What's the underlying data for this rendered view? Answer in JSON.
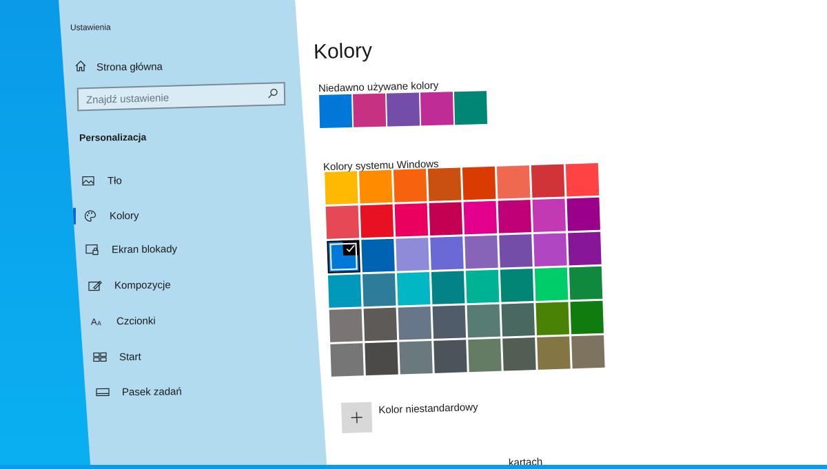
{
  "window": {
    "title": "Ustawienia"
  },
  "sidebar": {
    "home_label": "Strona główna",
    "search_placeholder": "Znajdź ustawienie",
    "section_title": "Personalizacja",
    "items": [
      {
        "label": "Tło",
        "icon": "picture-icon"
      },
      {
        "label": "Kolory",
        "icon": "palette-icon",
        "active": true
      },
      {
        "label": "Ekran blokady",
        "icon": "lock-screen-icon"
      },
      {
        "label": "Kompozycje",
        "icon": "themes-icon"
      },
      {
        "label": "Czcionki",
        "icon": "fonts-icon"
      },
      {
        "label": "Start",
        "icon": "start-icon"
      },
      {
        "label": "Pasek zadań",
        "icon": "taskbar-icon"
      }
    ]
  },
  "main": {
    "title": "Kolory",
    "recent_label": "Niedawno używane kolory",
    "recent_colors": [
      "#0078d7",
      "#c73181",
      "#744da9",
      "#c02c96",
      "#018574"
    ],
    "windows_label": "Kolory systemu Windows",
    "windows_colors": [
      [
        "#ffb900",
        "#ff8c00",
        "#f7630c",
        "#ca5010",
        "#da3b01",
        "#ef6950",
        "#d13438",
        "#ff4343"
      ],
      [
        "#e74856",
        "#e81123",
        "#ea005e",
        "#c30052",
        "#e3008c",
        "#bf0077",
        "#c239b3",
        "#9a0089"
      ],
      [
        "#0078d7",
        "#0063b1",
        "#8e8cd8",
        "#6b69d6",
        "#8764b8",
        "#744da9",
        "#b146c2",
        "#881798"
      ],
      [
        "#0099bc",
        "#2d7d9a",
        "#00b7c3",
        "#038387",
        "#00b294",
        "#018574",
        "#00cc6a",
        "#10893e"
      ],
      [
        "#7a7574",
        "#5d5a58",
        "#68768a",
        "#515c6b",
        "#567c73",
        "#486860",
        "#498205",
        "#107c10"
      ],
      [
        "#767676",
        "#4c4a48",
        "#69797e",
        "#4a5459",
        "#647c64",
        "#525e54",
        "#847545",
        "#7e735f"
      ]
    ],
    "selected_color": "#0078d7",
    "custom_label": "Kolor niestandardowy",
    "cut_text": "kartach"
  }
}
